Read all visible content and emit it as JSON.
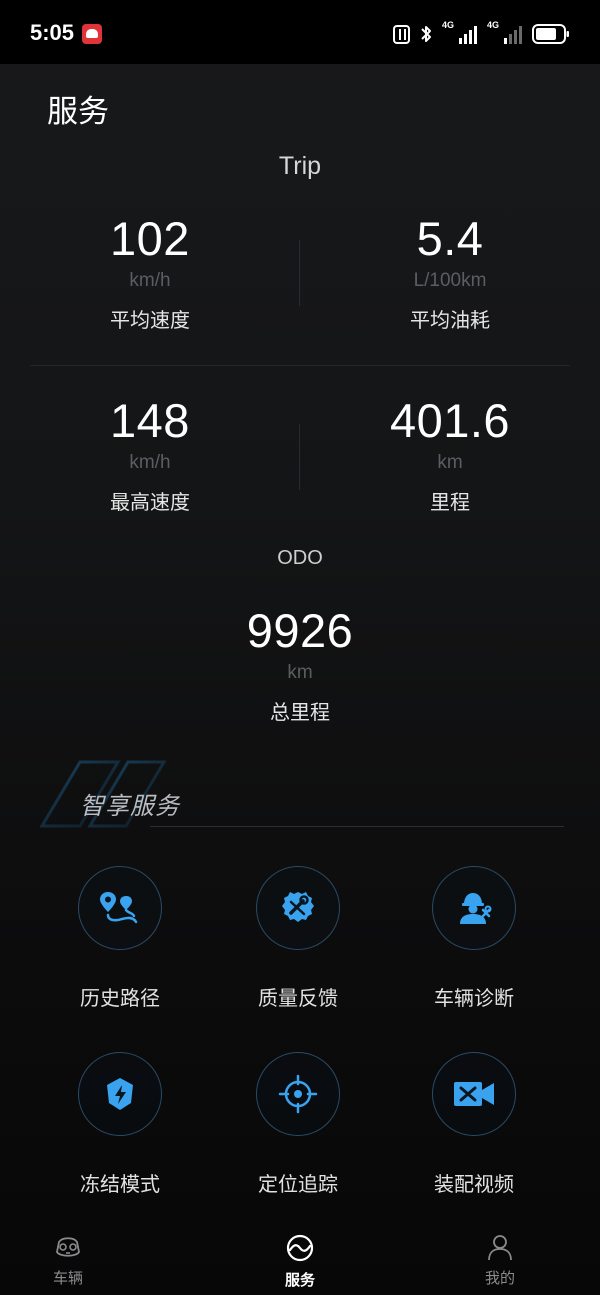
{
  "status_bar": {
    "time": "5:05",
    "signal1_label": "4G",
    "signal2_label": "4G"
  },
  "header": {
    "title": "服务"
  },
  "trip": {
    "label": "Trip",
    "avg_speed": {
      "value": "102",
      "unit": "km/h",
      "name": "平均速度"
    },
    "avg_fuel": {
      "value": "5.4",
      "unit": "L/100km",
      "name": "平均油耗"
    },
    "max_speed": {
      "value": "148",
      "unit": "km/h",
      "name": "最高速度"
    },
    "distance": {
      "value": "401.6",
      "unit": "km",
      "name": "里程"
    }
  },
  "odo": {
    "label": "ODO",
    "total": {
      "value": "9926",
      "unit": "km",
      "name": "总里程"
    }
  },
  "smart_services": {
    "title": "智享服务",
    "items": [
      {
        "label": "历史路径",
        "icon": "route-history-icon"
      },
      {
        "label": "质量反馈",
        "icon": "quality-feedback-icon"
      },
      {
        "label": "车辆诊断",
        "icon": "vehicle-diagnosis-icon"
      },
      {
        "label": "冻结模式",
        "icon": "freeze-mode-icon"
      },
      {
        "label": "定位追踪",
        "icon": "location-tracking-icon"
      },
      {
        "label": "装配视频",
        "icon": "assembly-video-icon"
      }
    ]
  },
  "bottom_nav": {
    "items": [
      {
        "label": "车辆",
        "active": false
      },
      {
        "label": "服务",
        "active": true
      },
      {
        "label": "我的",
        "active": false
      }
    ]
  },
  "colors": {
    "accent": "#3aa3f0",
    "background": "#121314",
    "circle_border": "#2b4a64"
  }
}
